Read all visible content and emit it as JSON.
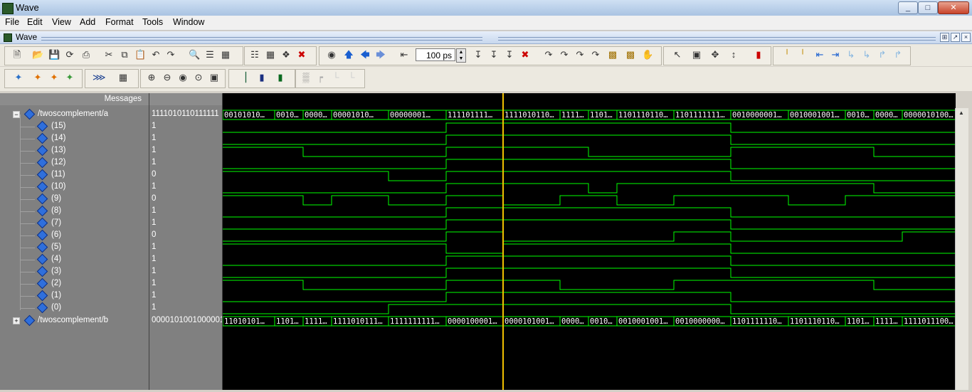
{
  "window": {
    "title": "Wave"
  },
  "menu": [
    "File",
    "Edit",
    "View",
    "Add",
    "Format",
    "Tools",
    "Window"
  ],
  "pane": {
    "title": "Wave"
  },
  "toolbar": {
    "time_value": "100 ps"
  },
  "headers": {
    "messages": "Messages"
  },
  "colors": {
    "wave_green": "#00ff00",
    "cursor_yellow": "#f0c000",
    "bus_white": "#ffffff",
    "background": "#000000"
  },
  "signals": [
    {
      "name": "/twoscomplement/a",
      "value": "1111010110111111",
      "expanded": true
    },
    {
      "name": "(15)",
      "value": "1"
    },
    {
      "name": "(14)",
      "value": "1"
    },
    {
      "name": "(13)",
      "value": "1"
    },
    {
      "name": "(12)",
      "value": "1"
    },
    {
      "name": "(11)",
      "value": "0"
    },
    {
      "name": "(10)",
      "value": "1"
    },
    {
      "name": "(9)",
      "value": "0"
    },
    {
      "name": "(8)",
      "value": "1"
    },
    {
      "name": "(7)",
      "value": "1"
    },
    {
      "name": "(6)",
      "value": "0"
    },
    {
      "name": "(5)",
      "value": "1"
    },
    {
      "name": "(4)",
      "value": "1"
    },
    {
      "name": "(3)",
      "value": "1"
    },
    {
      "name": "(2)",
      "value": "1"
    },
    {
      "name": "(1)",
      "value": "1"
    },
    {
      "name": "(0)",
      "value": "1"
    },
    {
      "name": "/twoscomplement/b",
      "value": "0000101001000001",
      "expanded": false
    }
  ],
  "bus_a_labels": [
    "00101010…",
    "0010…",
    "0000…",
    "00001010…",
    "00000001…",
    "111101111…",
    "1111010110…",
    "1111…",
    "1101…",
    "1101110110…",
    "1101111111…",
    "0010000001…",
    "0010001001…",
    "0010…",
    "0000…",
    "0000010100…"
  ],
  "bus_b_labels": [
    "11010101…",
    "1101…",
    "1111…",
    "1111010111…",
    "1111111111…",
    "0000100001…",
    "0000101001…",
    "0000…",
    "0010…",
    "0010001001…",
    "0010000000…",
    "1101111110…",
    "1101110110…",
    "1101…",
    "1111…",
    "1111011100…"
  ],
  "bits": [
    [
      0,
      0,
      0,
      0,
      0,
      1,
      1,
      1,
      1,
      1,
      1,
      0,
      0,
      0,
      0,
      0
    ],
    [
      0,
      0,
      0,
      0,
      0,
      1,
      1,
      1,
      1,
      1,
      1,
      0,
      0,
      0,
      0,
      0
    ],
    [
      1,
      1,
      0,
      0,
      0,
      1,
      1,
      1,
      0,
      0,
      0,
      1,
      1,
      1,
      0,
      0
    ],
    [
      0,
      0,
      0,
      0,
      0,
      1,
      1,
      1,
      1,
      1,
      1,
      0,
      0,
      0,
      0,
      0
    ],
    [
      1,
      1,
      1,
      1,
      0,
      1,
      1,
      1,
      1,
      1,
      1,
      0,
      0,
      0,
      0,
      0
    ],
    [
      0,
      0,
      0,
      0,
      0,
      1,
      1,
      1,
      0,
      1,
      1,
      1,
      1,
      1,
      0,
      0
    ],
    [
      1,
      1,
      0,
      1,
      0,
      1,
      0,
      1,
      1,
      0,
      1,
      1,
      0,
      1,
      1,
      1
    ],
    [
      0,
      0,
      0,
      0,
      0,
      1,
      1,
      1,
      1,
      1,
      1,
      0,
      0,
      0,
      0,
      0
    ],
    [
      0,
      0,
      0,
      0,
      0,
      1,
      1,
      1,
      1,
      1,
      1,
      0,
      0,
      0,
      0,
      0
    ],
    [
      0,
      0,
      0,
      0,
      0,
      1,
      0,
      0,
      0,
      0,
      1,
      0,
      0,
      0,
      0,
      1
    ],
    [
      1,
      1,
      1,
      1,
      1,
      0,
      1,
      1,
      1,
      1,
      1,
      0,
      0,
      0,
      0,
      0
    ],
    [
      0,
      0,
      0,
      0,
      0,
      1,
      1,
      1,
      1,
      1,
      1,
      0,
      0,
      0,
      0,
      0
    ],
    [
      0,
      0,
      0,
      0,
      0,
      1,
      1,
      1,
      1,
      1,
      1,
      0,
      0,
      0,
      0,
      0
    ],
    [
      1,
      1,
      0,
      0,
      0,
      1,
      1,
      0,
      0,
      0,
      1,
      1,
      1,
      1,
      0,
      0
    ],
    [
      0,
      0,
      0,
      0,
      0,
      1,
      1,
      1,
      1,
      1,
      1,
      0,
      0,
      0,
      0,
      0
    ],
    [
      0,
      0,
      0,
      0,
      1,
      1,
      1,
      1,
      1,
      1,
      1,
      0,
      0,
      0,
      0,
      0
    ]
  ]
}
